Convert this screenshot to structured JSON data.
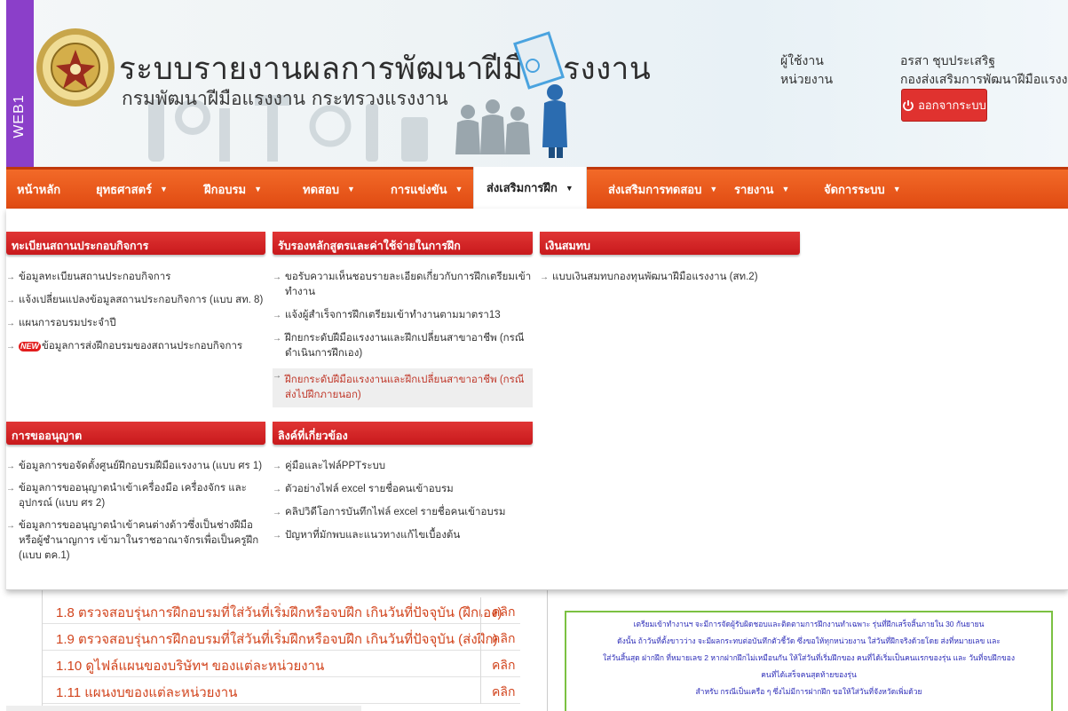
{
  "header": {
    "side_tab": "WEB1",
    "title": "ระบบรายงานผลการพัฒนาฝีมือแรงงาน",
    "subtitle": "กรมพัฒนาฝีมือแรงงาน กระทรวงแรงงาน",
    "user_label": "ผู้ใช้งาน",
    "unit_label": "หน่วยงาน",
    "user_name": "อรสา ชุบประเสริฐ",
    "unit_name": "กองส่งเสริมการพัฒนาฝีมือแรงงาน",
    "logout_label": "ออกจากระบบ",
    "logout_icon": "power-icon"
  },
  "nav": {
    "items": [
      {
        "label": "หน้าหลัก",
        "has_caret": false
      },
      {
        "label": "ยุทธศาสตร์",
        "has_caret": true
      },
      {
        "label": "ฝึกอบรม",
        "has_caret": true
      },
      {
        "label": "ทดสอบ",
        "has_caret": true
      },
      {
        "label": "การแข่งขัน",
        "has_caret": true
      },
      {
        "label": "ส่งเสริมการฝึก",
        "has_caret": true,
        "active": true
      },
      {
        "label": "ส่งเสริมการทดสอบ",
        "has_caret": true
      },
      {
        "label": "รายงาน",
        "has_caret": true
      },
      {
        "label": "จัดการระบบ",
        "has_caret": true
      }
    ],
    "caret": "▼"
  },
  "menu": {
    "sections": [
      {
        "title": "ทะเบียนสถานประกอบกิจการ",
        "items": [
          "ข้อมูลทะเบียนสถานประกอบกิจการ",
          "แจ้งเปลี่ยนแปลงข้อมูลสถานประกอบกิจการ (แบบ สท. 8)",
          "แผนการอบรมประจำปี",
          "ข้อมูลการส่งฝึกอบรมของสถานประกอบกิจการ"
        ],
        "new_badge": "NEW"
      },
      {
        "title": "รับรองหลักสูตรและค่าใช้จ่ายในการฝึก",
        "items": [
          "ขอรับความเห็นชอบรายละเอียดเกี่ยวกับการฝึกเตรียมเข้าทำงาน",
          "แจ้งผู้สำเร็จการฝึกเตรียมเข้าทำงานตามมาตรา13",
          "ฝึกยกระดับฝีมือแรงงานและฝึกเปลี่ยนสาขาอาชีพ (กรณีดำเนินการฝึกเอง)",
          "ฝึกยกระดับฝีมือแรงงานและฝึกเปลี่ยนสาขาอาชีพ (กรณีส่งไปฝึกภายนอก)"
        ]
      },
      {
        "title": "เงินสมทบ",
        "items": [
          "แบบเงินสมทบกองทุนพัฒนาฝีมือแรงงาน (สท.2)"
        ]
      },
      {
        "title": "การขออนุญาต",
        "items": [
          "ข้อมูลการขอจัดตั้งศูนย์ฝึกอบรมฝีมือแรงงาน (แบบ ศร 1)",
          "ข้อมูลการขออนุญาตนำเข้าเครื่องมือ เครื่องจักร และ อุปกรณ์ (แบบ ศร 2)",
          "ข้อมูลการขออนุญาตนำเข้าคนต่างด้าวซึ่งเป็นช่างฝีมือหรือผู้ชำนาญการ เข้ามาในราชอาณาจักรเพื่อเป็นครูฝึก (แบบ ตค.1)"
        ]
      },
      {
        "title": "ลิงค์ที่เกี่ยวข้อง",
        "items": [
          "คู่มือและไฟล์PPTระบบ",
          "ตัวอย่างไฟล์ excel รายชื่อคนเข้าอบรม",
          "คลิปวิดีโอการบันทึกไฟล์ excel รายชื่อคนเข้าอบรม",
          "ปัญหาที่มักพบและแนวทางแก้ไขเบื้องต้น"
        ]
      }
    ]
  },
  "background_list": {
    "rows": [
      {
        "label": "1.8 ตรวจสอบรุ่นการฝึกอบรมที่ใส่วันที่เริ่มฝึกหรือจบฝึก เกินวันที่ปัจจุบัน (ฝึกเอง)",
        "action": "คลิก"
      },
      {
        "label": "1.9 ตรวจสอบรุ่นการฝึกอบรมที่ใส่วันที่เริ่มฝึกหรือจบฝึก เกินวันที่ปัจจุบัน (ส่งฝึก)",
        "action": "คลิก"
      },
      {
        "label": "1.10 ดูไฟล์แผนของบริษัทฯ ของแต่ละหน่วยงาน",
        "action": "คลิก"
      },
      {
        "label": "1.11 แผนงบของแต่ละหน่วยงาน",
        "action": "คลิก"
      }
    ]
  },
  "notice": {
    "lines": [
      "เตรียมเข้าทำงานฯ จะมีการจัดผู้รับผิดชอบและติดตามการฝึกงานทำเฉพาะ รุ่นที่ฝึกเสร็จสิ้นภายใน 30 กันยายน",
      "ดังนั้น ถ้าวันที่ตั้งขาวว่าง จะมีผลกระทบต่อบันทึกตัวชี้วัด ซึ่งขอให้ทุกหน่วยงาน ใส่วันที่ฝึกจริงด้วยโดย ส่งที่หมายเลข และ",
      "ใส่วันสิ้นสุด ฝากฝึก ที่หมายเลข 2 หากฝากฝึกไม่เหมือนกัน ให้ใส่วันที่เริ่มฝึกของ คนที่ได้เริ่มเป็นคนแรกของรุ่น และ วันที่จบฝึกของ",
      "คนที่ได้เสร็จคนสุดท้ายของรุ่น",
      "สำหรับ กรณีเป็นเครือ ๆ ซึ่งไม่มีการฝากฝึก ขอให้ใส่วันที่จังหวัดเพิ่มด้วย"
    ]
  },
  "colors": {
    "nav_orange": "#e8561a",
    "section_red": "#d42a2a",
    "side_tab_purple": "#8b3fc9",
    "link_orange": "#d2451e",
    "notice_border": "#7bc142"
  }
}
